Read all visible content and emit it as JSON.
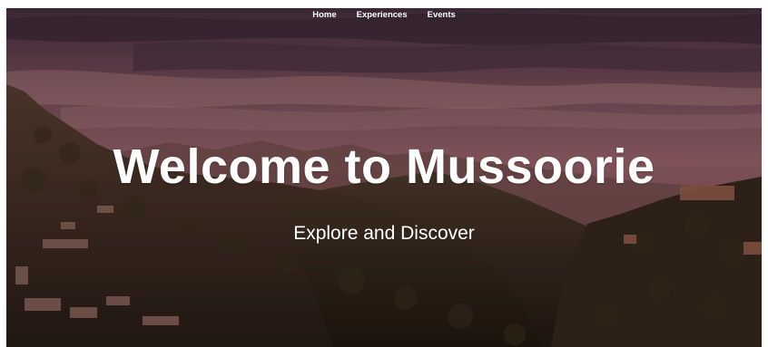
{
  "nav": {
    "items": [
      {
        "label": "Home"
      },
      {
        "label": "Experiences"
      },
      {
        "label": "Events"
      }
    ]
  },
  "hero": {
    "title": "Welcome to Mussoorie",
    "subtitle": "Explore and Discover"
  }
}
